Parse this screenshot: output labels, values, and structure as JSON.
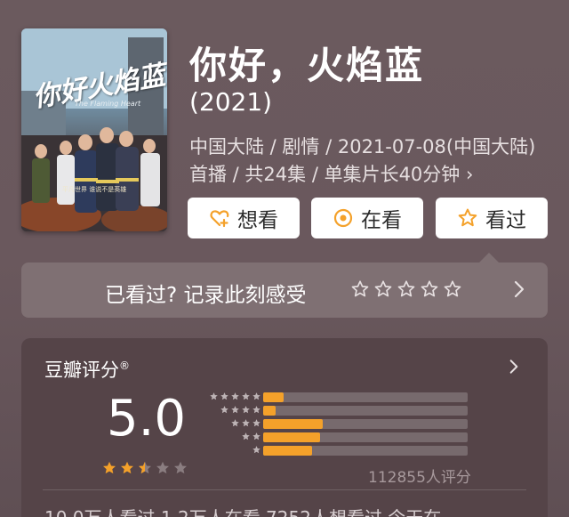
{
  "poster": {
    "calligraphy": "你好火焰蓝",
    "subtitle": "The Flaming Heart",
    "tagline": "平凡世界 谁说不是英雄"
  },
  "title": "你好，火焰蓝",
  "year": "(2021)",
  "meta": "中国大陆 / 剧情 / 2021-07-08(中国大陆)首播 / 共24集 / 单集片长40分钟 ›",
  "actions": {
    "want_label": "想看",
    "doing_label": "在看",
    "done_label": "看过"
  },
  "record": {
    "label": "已看过? 记录此刻感受",
    "star_count": 5
  },
  "rating": {
    "header": "豆瓣评分",
    "registered_mark": "®",
    "score": "5.0",
    "stars": 2.5,
    "distribution": [
      0.1,
      0.06,
      0.29,
      0.28,
      0.24
    ],
    "count_label": "112855人评分"
  },
  "bottom_stats": "10.0万人看过   1.2万人在看   7252人想看过   今天在",
  "colors": {
    "accent": "#f4a12a",
    "card_bg": "#7f7073",
    "rating_bg": "#554448"
  }
}
